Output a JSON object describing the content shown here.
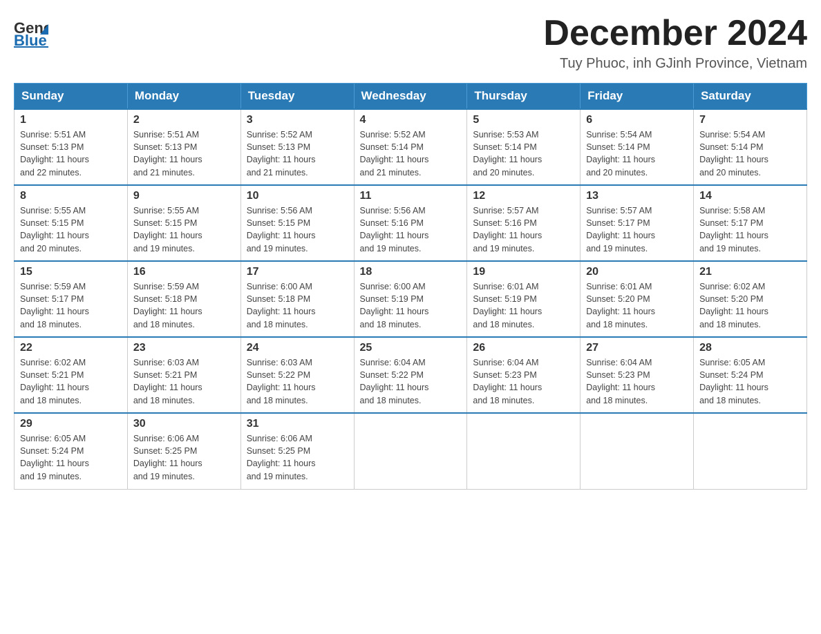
{
  "header": {
    "logo_general": "General",
    "logo_blue": "Blue",
    "month_title": "December 2024",
    "location": "Tuy Phuoc, inh GJinh Province, Vietnam"
  },
  "days_of_week": [
    "Sunday",
    "Monday",
    "Tuesday",
    "Wednesday",
    "Thursday",
    "Friday",
    "Saturday"
  ],
  "weeks": [
    [
      {
        "day": "1",
        "sunrise": "5:51 AM",
        "sunset": "5:13 PM",
        "daylight": "11 hours and 22 minutes."
      },
      {
        "day": "2",
        "sunrise": "5:51 AM",
        "sunset": "5:13 PM",
        "daylight": "11 hours and 21 minutes."
      },
      {
        "day": "3",
        "sunrise": "5:52 AM",
        "sunset": "5:13 PM",
        "daylight": "11 hours and 21 minutes."
      },
      {
        "day": "4",
        "sunrise": "5:52 AM",
        "sunset": "5:14 PM",
        "daylight": "11 hours and 21 minutes."
      },
      {
        "day": "5",
        "sunrise": "5:53 AM",
        "sunset": "5:14 PM",
        "daylight": "11 hours and 20 minutes."
      },
      {
        "day": "6",
        "sunrise": "5:54 AM",
        "sunset": "5:14 PM",
        "daylight": "11 hours and 20 minutes."
      },
      {
        "day": "7",
        "sunrise": "5:54 AM",
        "sunset": "5:14 PM",
        "daylight": "11 hours and 20 minutes."
      }
    ],
    [
      {
        "day": "8",
        "sunrise": "5:55 AM",
        "sunset": "5:15 PM",
        "daylight": "11 hours and 20 minutes."
      },
      {
        "day": "9",
        "sunrise": "5:55 AM",
        "sunset": "5:15 PM",
        "daylight": "11 hours and 19 minutes."
      },
      {
        "day": "10",
        "sunrise": "5:56 AM",
        "sunset": "5:15 PM",
        "daylight": "11 hours and 19 minutes."
      },
      {
        "day": "11",
        "sunrise": "5:56 AM",
        "sunset": "5:16 PM",
        "daylight": "11 hours and 19 minutes."
      },
      {
        "day": "12",
        "sunrise": "5:57 AM",
        "sunset": "5:16 PM",
        "daylight": "11 hours and 19 minutes."
      },
      {
        "day": "13",
        "sunrise": "5:57 AM",
        "sunset": "5:17 PM",
        "daylight": "11 hours and 19 minutes."
      },
      {
        "day": "14",
        "sunrise": "5:58 AM",
        "sunset": "5:17 PM",
        "daylight": "11 hours and 19 minutes."
      }
    ],
    [
      {
        "day": "15",
        "sunrise": "5:59 AM",
        "sunset": "5:17 PM",
        "daylight": "11 hours and 18 minutes."
      },
      {
        "day": "16",
        "sunrise": "5:59 AM",
        "sunset": "5:18 PM",
        "daylight": "11 hours and 18 minutes."
      },
      {
        "day": "17",
        "sunrise": "6:00 AM",
        "sunset": "5:18 PM",
        "daylight": "11 hours and 18 minutes."
      },
      {
        "day": "18",
        "sunrise": "6:00 AM",
        "sunset": "5:19 PM",
        "daylight": "11 hours and 18 minutes."
      },
      {
        "day": "19",
        "sunrise": "6:01 AM",
        "sunset": "5:19 PM",
        "daylight": "11 hours and 18 minutes."
      },
      {
        "day": "20",
        "sunrise": "6:01 AM",
        "sunset": "5:20 PM",
        "daylight": "11 hours and 18 minutes."
      },
      {
        "day": "21",
        "sunrise": "6:02 AM",
        "sunset": "5:20 PM",
        "daylight": "11 hours and 18 minutes."
      }
    ],
    [
      {
        "day": "22",
        "sunrise": "6:02 AM",
        "sunset": "5:21 PM",
        "daylight": "11 hours and 18 minutes."
      },
      {
        "day": "23",
        "sunrise": "6:03 AM",
        "sunset": "5:21 PM",
        "daylight": "11 hours and 18 minutes."
      },
      {
        "day": "24",
        "sunrise": "6:03 AM",
        "sunset": "5:22 PM",
        "daylight": "11 hours and 18 minutes."
      },
      {
        "day": "25",
        "sunrise": "6:04 AM",
        "sunset": "5:22 PM",
        "daylight": "11 hours and 18 minutes."
      },
      {
        "day": "26",
        "sunrise": "6:04 AM",
        "sunset": "5:23 PM",
        "daylight": "11 hours and 18 minutes."
      },
      {
        "day": "27",
        "sunrise": "6:04 AM",
        "sunset": "5:23 PM",
        "daylight": "11 hours and 18 minutes."
      },
      {
        "day": "28",
        "sunrise": "6:05 AM",
        "sunset": "5:24 PM",
        "daylight": "11 hours and 18 minutes."
      }
    ],
    [
      {
        "day": "29",
        "sunrise": "6:05 AM",
        "sunset": "5:24 PM",
        "daylight": "11 hours and 19 minutes."
      },
      {
        "day": "30",
        "sunrise": "6:06 AM",
        "sunset": "5:25 PM",
        "daylight": "11 hours and 19 minutes."
      },
      {
        "day": "31",
        "sunrise": "6:06 AM",
        "sunset": "5:25 PM",
        "daylight": "11 hours and 19 minutes."
      },
      null,
      null,
      null,
      null
    ]
  ],
  "labels": {
    "sunrise_prefix": "Sunrise: ",
    "sunset_prefix": "Sunset: ",
    "daylight_prefix": "Daylight: "
  }
}
